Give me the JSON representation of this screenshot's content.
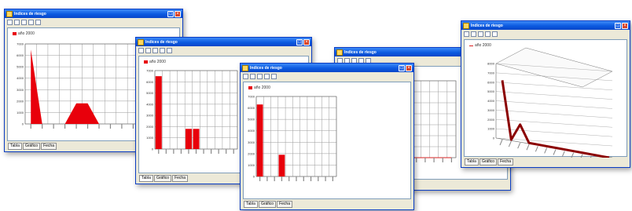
{
  "window_title": "Indices de riesgo",
  "legend_label": "año 2000",
  "tabs": [
    "Tabla",
    "Gráfico",
    "Fecha"
  ],
  "colors": {
    "series": "#e8000b",
    "line": "#d92020",
    "grid": "#9a9a9a"
  },
  "chart_data": [
    {
      "type": "area",
      "y_ticks": [
        "7000",
        "6000",
        "5000",
        "4000",
        "3000",
        "2000",
        "1000",
        "0"
      ],
      "values": [
        6500,
        0,
        0,
        0,
        1800,
        1800,
        0,
        0,
        0,
        0,
        0,
        0,
        0
      ]
    },
    {
      "type": "bar",
      "y_ticks": [
        "7000",
        "6000",
        "5000",
        "4000",
        "3000",
        "2000",
        "1000",
        "0"
      ],
      "values": [
        6500,
        0,
        0,
        0,
        1800,
        1800,
        0,
        0,
        0,
        0,
        0
      ]
    },
    {
      "type": "bar",
      "y_ticks": [
        "7000",
        "6000",
        "5000",
        "4000",
        "3000",
        "2000",
        "1000",
        "0"
      ],
      "values": [
        6300,
        0,
        0,
        1900,
        0,
        0,
        0,
        0,
        0,
        0,
        0
      ]
    },
    {
      "type": "line",
      "y_ticks": [
        "7000",
        "6000",
        "5000",
        "4000",
        "3000",
        "2000",
        "1000",
        "0"
      ],
      "values": [
        6200,
        0,
        0,
        1800,
        1800,
        0,
        0,
        0,
        0,
        0,
        0,
        0
      ]
    },
    {
      "type": "line-3d",
      "y_ticks": [
        "8000",
        "7000",
        "6000",
        "5000",
        "4000",
        "3000",
        "2000",
        "1000",
        "0"
      ],
      "values": [
        6200,
        0,
        1800,
        0,
        0,
        0,
        0,
        0,
        0,
        0,
        0,
        0,
        0
      ]
    }
  ]
}
